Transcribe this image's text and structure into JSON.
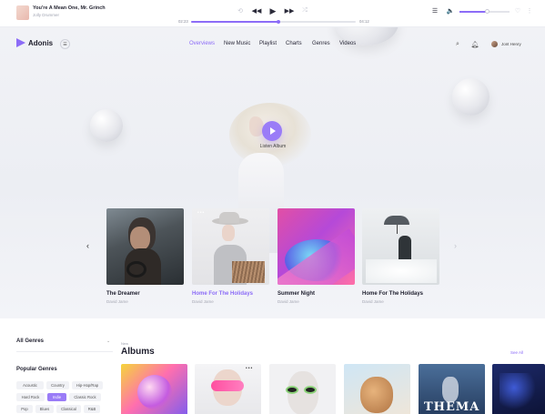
{
  "player": {
    "track_title": "You're A Mean One, Mr. Grinch",
    "track_artist": "Jolly Drummer",
    "time_elapsed": "02:23",
    "time_total": "04:12",
    "progress": 0.53,
    "volume": 0.55
  },
  "header": {
    "logo": "Adonis",
    "nav": [
      "Overviews",
      "New Music",
      "Playlist",
      "Charts",
      "Genres",
      "Videos"
    ],
    "active_nav": "Overviews",
    "user_name": "Jont Henry"
  },
  "hero": {
    "cta_label": "Listen Album"
  },
  "featured_cards": [
    {
      "title": "The Dreamer",
      "artist": "David Jame"
    },
    {
      "title": "Home For The Holidays",
      "artist": "David Jame",
      "active": true
    },
    {
      "title": "Summer Night",
      "artist": "David Jame"
    },
    {
      "title": "Home For The Holidays",
      "artist": "David Jame"
    }
  ],
  "sidebar": {
    "genre_select": "All Genres",
    "popular_title": "Popular Genres",
    "tags": [
      "Acoustic",
      "Country",
      "Hip-Hop/Rap",
      "Hard Rock",
      "Indie",
      "Classic Rock",
      "Pop",
      "Blues",
      "Classical",
      "R&B"
    ],
    "active_tag": "Indie"
  },
  "albums": {
    "breadcrumb": "New",
    "title": "Albums",
    "see_all": "See All",
    "thema_text": "THEMA"
  },
  "colors": {
    "accent": "#8c6cf7",
    "text": "#1f1f2e",
    "muted": "#a5a7b3"
  }
}
